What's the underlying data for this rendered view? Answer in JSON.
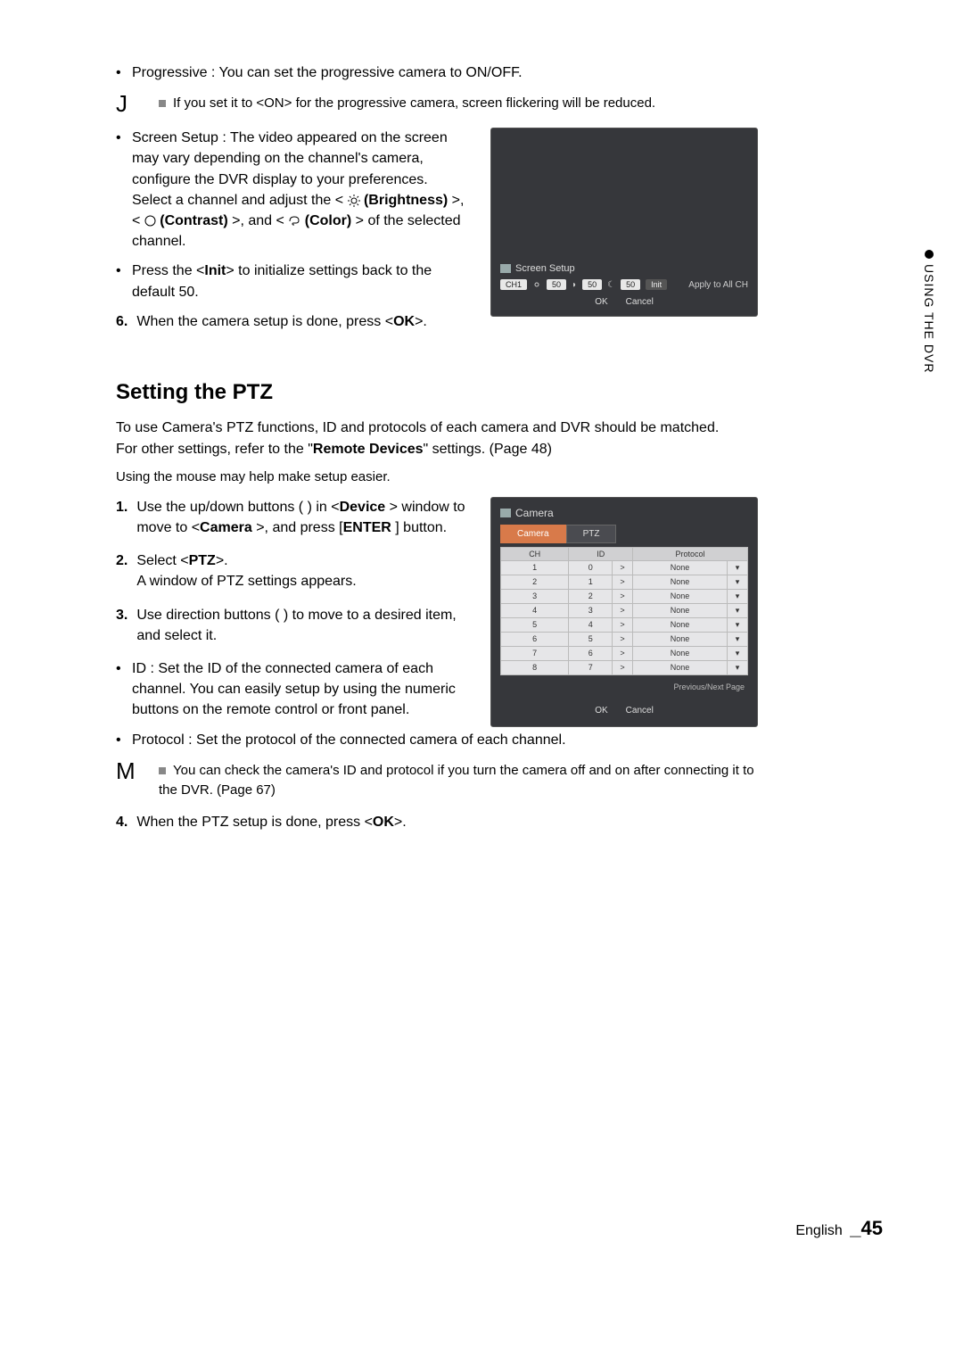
{
  "sidebar_label": "USING THE DVR",
  "bullet1": "Progressive : You can set the progressive camera to ON/OFF.",
  "noteJ": {
    "letter": "J",
    "text": "If you set it to <ON> for the progressive camera, screen flickering will be reduced."
  },
  "bullet2a": "Screen Setup : The video appeared on the screen may vary depending on the channel's camera, configure the DVR display to your preferences.",
  "bullet2b_pre": "Select a channel and adjust the <",
  "bullet2b_bright": "(Brightness)",
  "bullet2b_mid1": ">, <",
  "bullet2b_contrast": "(Contrast)",
  "bullet2b_mid2": ">, and <",
  "bullet2b_color": "(Color)",
  "bullet2b_post": "> of the selected channel.",
  "bullet3_pre": "Press the <",
  "bullet3_init": "Init",
  "bullet3_post": "> to initialize settings back to the default 50.",
  "step6_num": "6.",
  "step6_pre": "When the camera setup is done, press <",
  "step6_ok": "OK",
  "step6_post": ">.",
  "ss1": {
    "title": "Screen Setup",
    "ch": "CH1",
    "v1": "50",
    "v2": "50",
    "v3": "50",
    "init": "Init",
    "apply": "Apply to All CH",
    "ok": "OK",
    "cancel": "Cancel"
  },
  "ptz_heading": "Setting the PTZ",
  "ptz_intro1": "To use Camera's PTZ functions, ID and protocols of each camera and DVR should be matched.",
  "ptz_intro2_pre": "For other settings, refer to the \"",
  "ptz_intro2_bold": "Remote Devices",
  "ptz_intro2_post": "\" settings. (Page 48)",
  "ptz_hint": "Using the mouse may help make setup easier.",
  "step1_num": "1.",
  "step1_a": "Use the up/down buttons (",
  "step1_b": ") in <",
  "step1_dev": "Device",
  "step1_c": "> window to move to <",
  "step1_cam": "Camera",
  "step1_d": ">, and press [",
  "step1_enter": "ENTER",
  "step1_e": "] button.",
  "step2_num": "2.",
  "step2_a": "Select <",
  "step2_ptz": "PTZ",
  "step2_b": ">.",
  "step2_c": "A window of PTZ settings appears.",
  "step3_num": "3.",
  "step3_a": "Use direction buttons (",
  "step3_b": ") to move to a desired item, and select it.",
  "bullet_id": "ID : Set the ID of the connected camera of each channel. You can easily setup by using the numeric buttons on the remote control or front panel.",
  "bullet_proto": "Protocol : Set the protocol of the connected camera of each channel.",
  "noteM": {
    "letter": "M",
    "text": "You can check the camera's ID and protocol if you turn the camera off and on after connecting it to the DVR. (Page 67)"
  },
  "step4_num": "4.",
  "step4_a": "When the PTZ setup is done, press <",
  "step4_ok": "OK",
  "step4_b": ">.",
  "ss2": {
    "title": "Camera",
    "tab_camera": "Camera",
    "tab_ptz": "PTZ",
    "h_ch": "CH",
    "h_id": "ID",
    "h_proto": "Protocol",
    "rows": [
      {
        "ch": "1",
        "id": "0",
        "p": "None"
      },
      {
        "ch": "2",
        "id": "1",
        "p": "None"
      },
      {
        "ch": "3",
        "id": "2",
        "p": "None"
      },
      {
        "ch": "4",
        "id": "3",
        "p": "None"
      },
      {
        "ch": "5",
        "id": "4",
        "p": "None"
      },
      {
        "ch": "6",
        "id": "5",
        "p": "None"
      },
      {
        "ch": "7",
        "id": "6",
        "p": "None"
      },
      {
        "ch": "8",
        "id": "7",
        "p": "None"
      }
    ],
    "pager": "Previous/Next Page",
    "ok": "OK",
    "cancel": "Cancel"
  },
  "footer_lang": "English",
  "footer_page": "_45"
}
